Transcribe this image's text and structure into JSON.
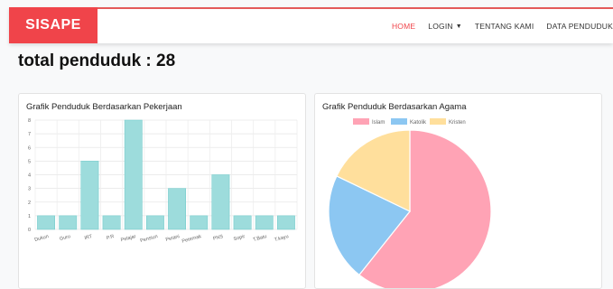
{
  "brand": "SISAPE",
  "nav": {
    "home": "HOME",
    "login": "LOGIN",
    "tentang": "TENTANG KAMI",
    "data": "DATA PENDUDUK"
  },
  "total_label": "total penduduk : 28",
  "charts": {
    "pekerjaan_title": "Grafik Penduduk Berdasarkan Pekerjaan",
    "agama_title": "Grafik Penduduk Berdasarkan Agama"
  },
  "colors": {
    "brand": "#f0444a",
    "bar_fill": "#9ddcdc",
    "bar_stroke": "#6cc9c9",
    "islam": "#ffa3b5",
    "katolik": "#8cc7f2",
    "kristen": "#ffdf9c"
  },
  "chart_data": [
    {
      "type": "bar",
      "title": "Grafik Penduduk Berdasarkan Pekerjaan",
      "categories": [
        "Dukun",
        "Guru",
        "IRT",
        "P.R",
        "Pelajar",
        "Pensiun",
        "Petani",
        "Peternak",
        "PNS",
        "Sopir",
        "T.Batu",
        "T.kayu"
      ],
      "values": [
        1,
        1,
        5,
        1,
        8,
        1,
        3,
        1,
        4,
        1,
        1,
        1
      ],
      "ylim": [
        0,
        8
      ],
      "yticks": [
        0,
        1,
        2,
        3,
        4,
        5,
        6,
        7,
        8
      ],
      "grid": true
    },
    {
      "type": "pie",
      "title": "Grafik Penduduk Berdasarkan Agama",
      "labels": [
        "Islam",
        "Katolik",
        "Kristen"
      ],
      "values": [
        17,
        6,
        5
      ],
      "legend": "top"
    }
  ]
}
